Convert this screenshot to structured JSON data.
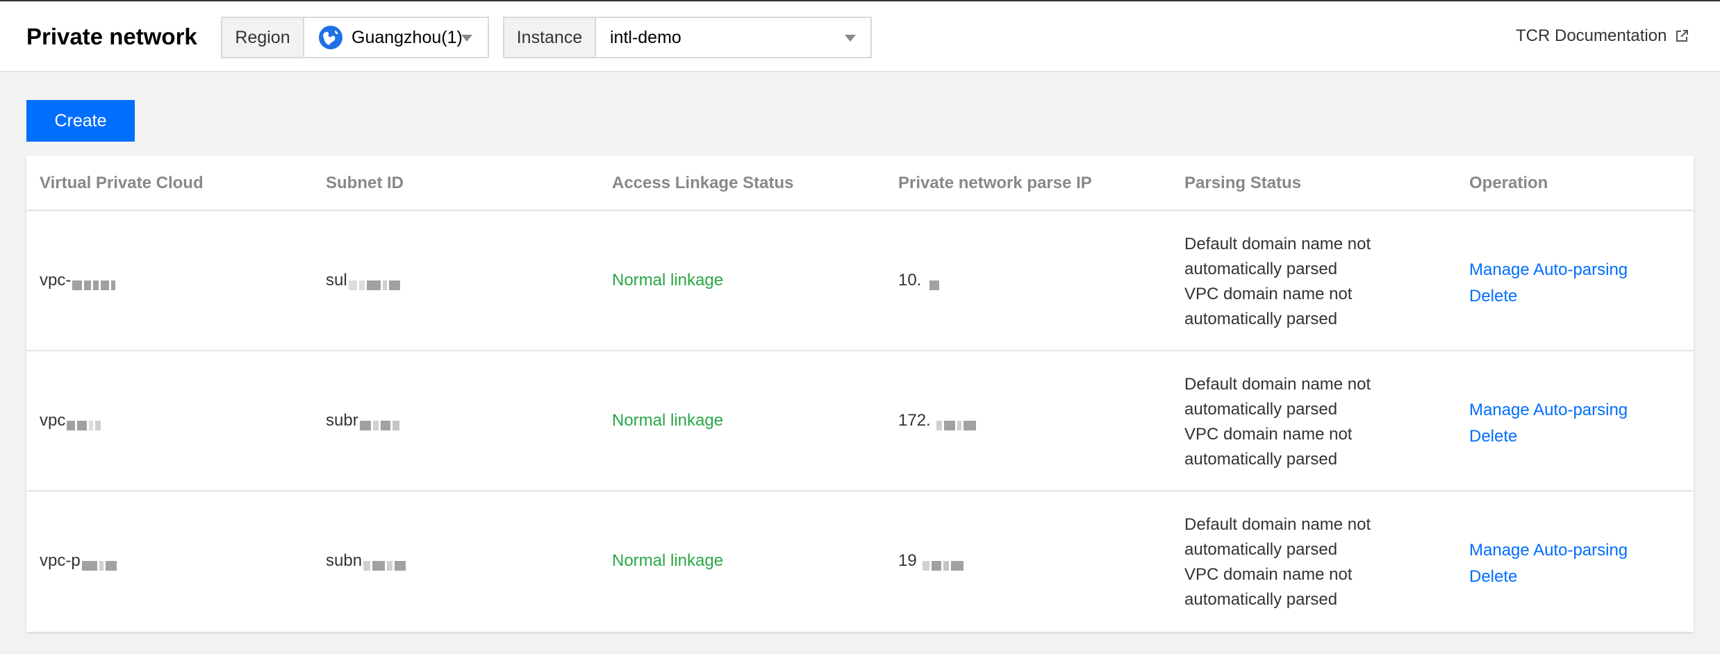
{
  "header": {
    "title": "Private network",
    "region": {
      "label": "Region",
      "value": "Guangzhou(1)"
    },
    "instance": {
      "label": "Instance",
      "value": "intl-demo"
    },
    "doc_link": "TCR Documentation"
  },
  "toolbar": {
    "create_label": "Create"
  },
  "table": {
    "columns": [
      "Virtual Private Cloud",
      "Subnet ID",
      "Access Linkage Status",
      "Private network parse IP",
      "Parsing Status",
      "Operation"
    ],
    "rows": [
      {
        "vpc": "vpc-",
        "subnet": "sul",
        "status": "Normal linkage",
        "ip": "10.",
        "parsing": [
          "Default domain name not",
          "automatically parsed",
          "VPC domain name not",
          "automatically parsed"
        ],
        "ops": [
          "Manage Auto-parsing",
          "Delete"
        ]
      },
      {
        "vpc": "vpc",
        "subnet": "subr",
        "status": "Normal linkage",
        "ip": "172.",
        "parsing": [
          "Default domain name not",
          "automatically parsed",
          "VPC domain name not",
          "automatically parsed"
        ],
        "ops": [
          "Manage Auto-parsing",
          "Delete"
        ]
      },
      {
        "vpc": "vpc-p",
        "subnet": "subn",
        "status": "Normal linkage",
        "ip": "19",
        "parsing": [
          "Default domain name not",
          "automatically parsed",
          "VPC domain name not",
          "automatically parsed"
        ],
        "ops": [
          "Manage Auto-parsing",
          "Delete"
        ]
      }
    ]
  },
  "icons": {
    "region": "globe-icon",
    "external": "external-link-icon",
    "dropdown": "chevron-down-icon"
  },
  "colors": {
    "primary": "#006eff",
    "success": "#29a745",
    "header_text": "#888888"
  }
}
